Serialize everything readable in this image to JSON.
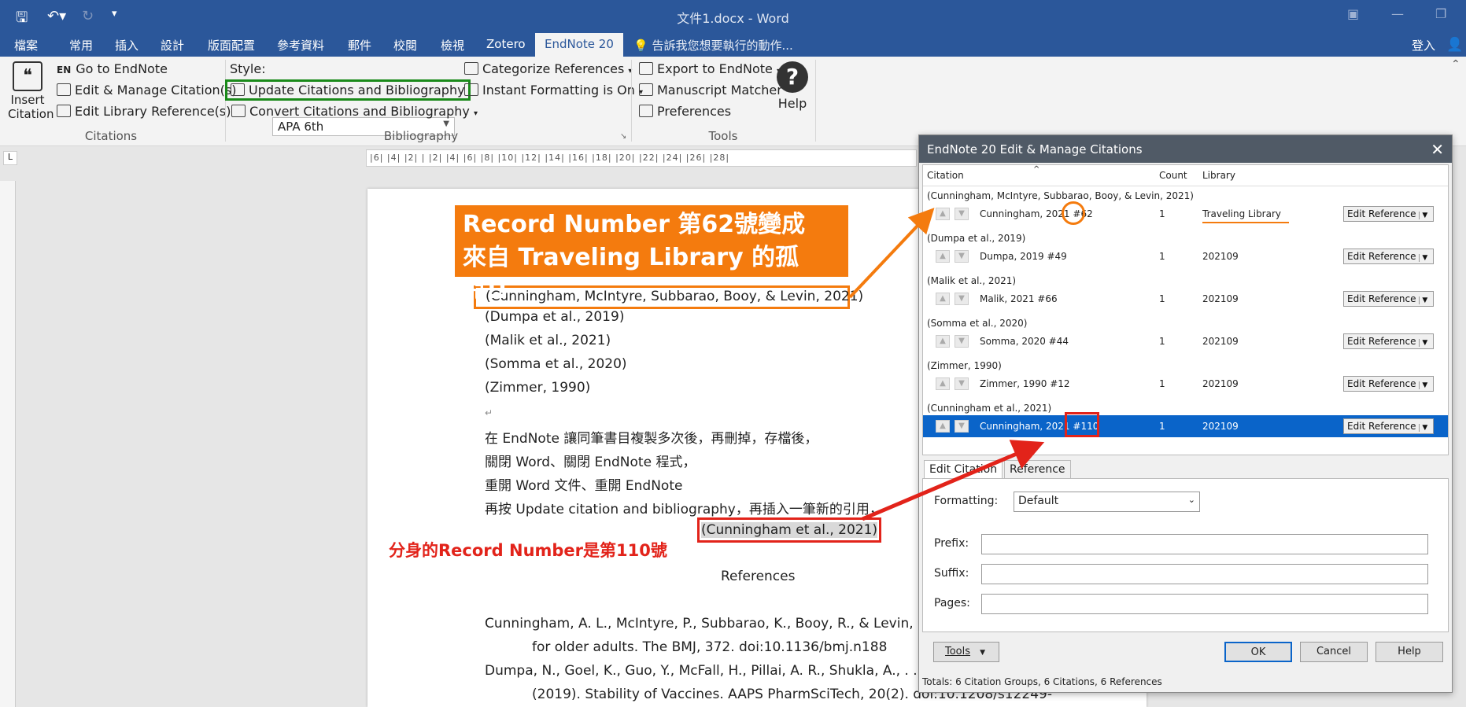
{
  "window": {
    "doc_title": "文件1.docx - Word",
    "signin": "登入"
  },
  "tabs": [
    "檔案",
    "常用",
    "插入",
    "設計",
    "版面配置",
    "參考資料",
    "郵件",
    "校閱",
    "檢視",
    "Zotero",
    "EndNote 20"
  ],
  "tell_me": "告訴我您想要執行的動作...",
  "ribbon": {
    "insert_citation": "Insert Citation",
    "go_to_endnote": "Go to EndNote",
    "edit_manage": "Edit & Manage Citation(s)",
    "edit_library": "Edit Library Reference(s)",
    "citations_group": "Citations",
    "style_label": "Style:",
    "style_value": "APA 6th",
    "update": "Update Citations and Bibliography",
    "convert": "Convert Citations and Bibliography",
    "bibliography_group": "Bibliography",
    "categorize": "Categorize References",
    "instant": "Instant Formatting is On",
    "export": "Export to EndNote",
    "manuscript": "Manuscript Matcher",
    "preferences": "Preferences",
    "tools_group": "Tools",
    "help": "Help"
  },
  "document": {
    "lines": [
      "(Cunningham, McIntyre, Subbarao, Booy, & Levin, 2021)",
      "(Dumpa et al., 2019)",
      "(Malik et al., 2021)",
      "(Somma et al., 2020)",
      "(Zimmer, 1990)",
      "",
      "在 EndNote 讓同筆書目複製多次後，再刪掉，存檔後，",
      "關閉 Word、關閉 EndNote 程式，",
      "重開 Word 文件、重開 EndNote",
      "再按 Update citation and bibliography，再插入一筆新的引用，",
      "(Cunningham et al., 2021)"
    ],
    "references_heading": "References",
    "ref1_a": "Cunningham, A. L., McIntyre, P., Subbarao, K., Booy, R., & Levin, M. J",
    "ref1_b": "for older adults. The BMJ, 372. doi:10.1136/bmj.n188",
    "ref2_a": "Dumpa, N., Goel, K., Guo, Y., McFall, H., Pillai, A. R., Shukla, A., . . . M",
    "ref2_b": "(2019). Stability of Vaccines. AAPS PharmSciTech, 20(2). doi:10.1208/s12249-"
  },
  "annotations": {
    "orange_line1": "Record Number 第62號變成",
    "orange_line2": "來自 Traveling Library 的孤兒!!",
    "red_note": "分身的Record Number是第110號"
  },
  "dialog": {
    "title": "EndNote 20 Edit & Manage Citations",
    "col_citation": "Citation",
    "col_count": "Count",
    "col_library": "Library",
    "groups": [
      {
        "label": "(Cunningham, McIntyre, Subbarao, Booy, & Levin, 2021)",
        "cite": "Cunningham, 2021 #62",
        "count": "1",
        "library": "Traveling Library"
      },
      {
        "label": "(Dumpa et al., 2019)",
        "cite": "Dumpa, 2019 #49",
        "count": "1",
        "library": "202109"
      },
      {
        "label": "(Malik et al., 2021)",
        "cite": "Malik, 2021 #66",
        "count": "1",
        "library": "202109"
      },
      {
        "label": "(Somma et al., 2020)",
        "cite": "Somma, 2020 #44",
        "count": "1",
        "library": "202109"
      },
      {
        "label": "(Zimmer, 1990)",
        "cite": "Zimmer, 1990 #12",
        "count": "1",
        "library": "202109"
      },
      {
        "label": "(Cunningham et al., 2021)",
        "cite": "Cunningham, 2021 #110",
        "count": "1",
        "library": "202109"
      }
    ],
    "edit_reference": "Edit Reference",
    "tab_edit_citation": "Edit Citation",
    "tab_reference": "Reference",
    "formatting_label": "Formatting:",
    "formatting_value": "Default",
    "prefix_label": "Prefix:",
    "suffix_label": "Suffix:",
    "pages_label": "Pages:",
    "tools_btn": "Tools",
    "ok": "OK",
    "cancel": "Cancel",
    "help": "Help",
    "totals": "Totals: 6 Citation Groups, 6 Citations, 6 References"
  },
  "colors": {
    "word_blue": "#2b579a",
    "orange": "#f47b0e",
    "red": "#e2231a",
    "green": "#1a8a1a",
    "select_blue": "#0a64c9"
  }
}
